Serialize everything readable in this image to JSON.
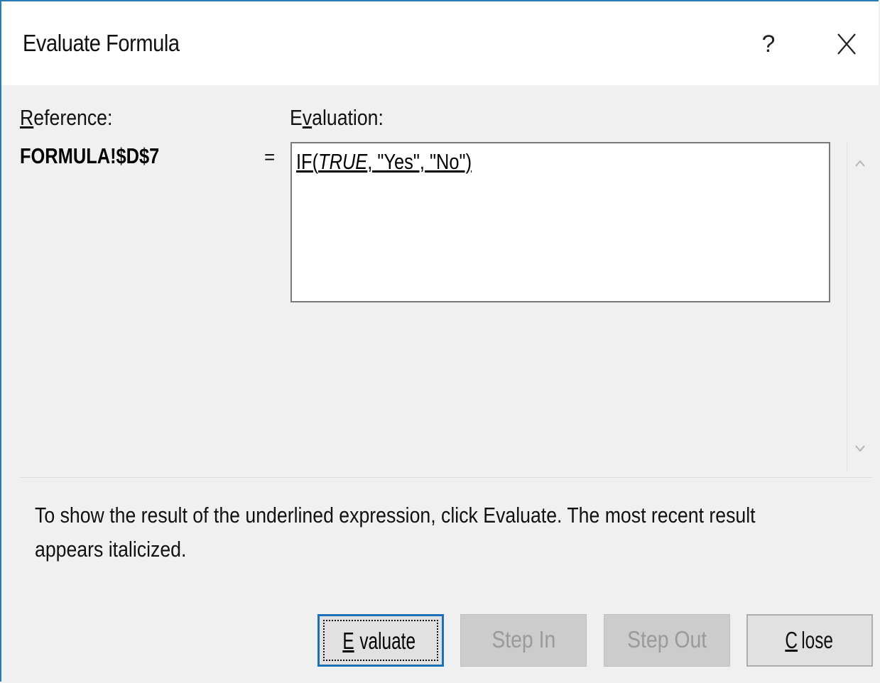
{
  "dialog": {
    "title": "Evaluate Formula",
    "help_label": "?",
    "close_icon": "close-icon"
  },
  "reference": {
    "label_underlined": "R",
    "label_rest": "eference:",
    "value": "FORMULA!$D$7"
  },
  "evaluation": {
    "label_first": "E",
    "label_underlined": "v",
    "label_rest": "aluation:",
    "equals": "=",
    "expr_prefix": "IF(",
    "expr_italic": "TRUE",
    "expr_suffix": ", \"Yes\", \"No\")"
  },
  "instructions": "To show the result of the underlined expression, click Evaluate.  The most recent result appears italicized.",
  "buttons": {
    "evaluate_underlined": "E",
    "evaluate_rest": "valuate",
    "step_in": "Step In",
    "step_out": "Step Out",
    "close_underlined": "C",
    "close_rest": "lose"
  },
  "colors": {
    "accent": "#1f6fb4",
    "window_border": "#2b7bb9",
    "background": "#f0f0f0",
    "disabled_button": "#cccccc"
  },
  "icons": {
    "scroll_up": "chevron-up-icon",
    "scroll_down": "chevron-down-icon"
  }
}
